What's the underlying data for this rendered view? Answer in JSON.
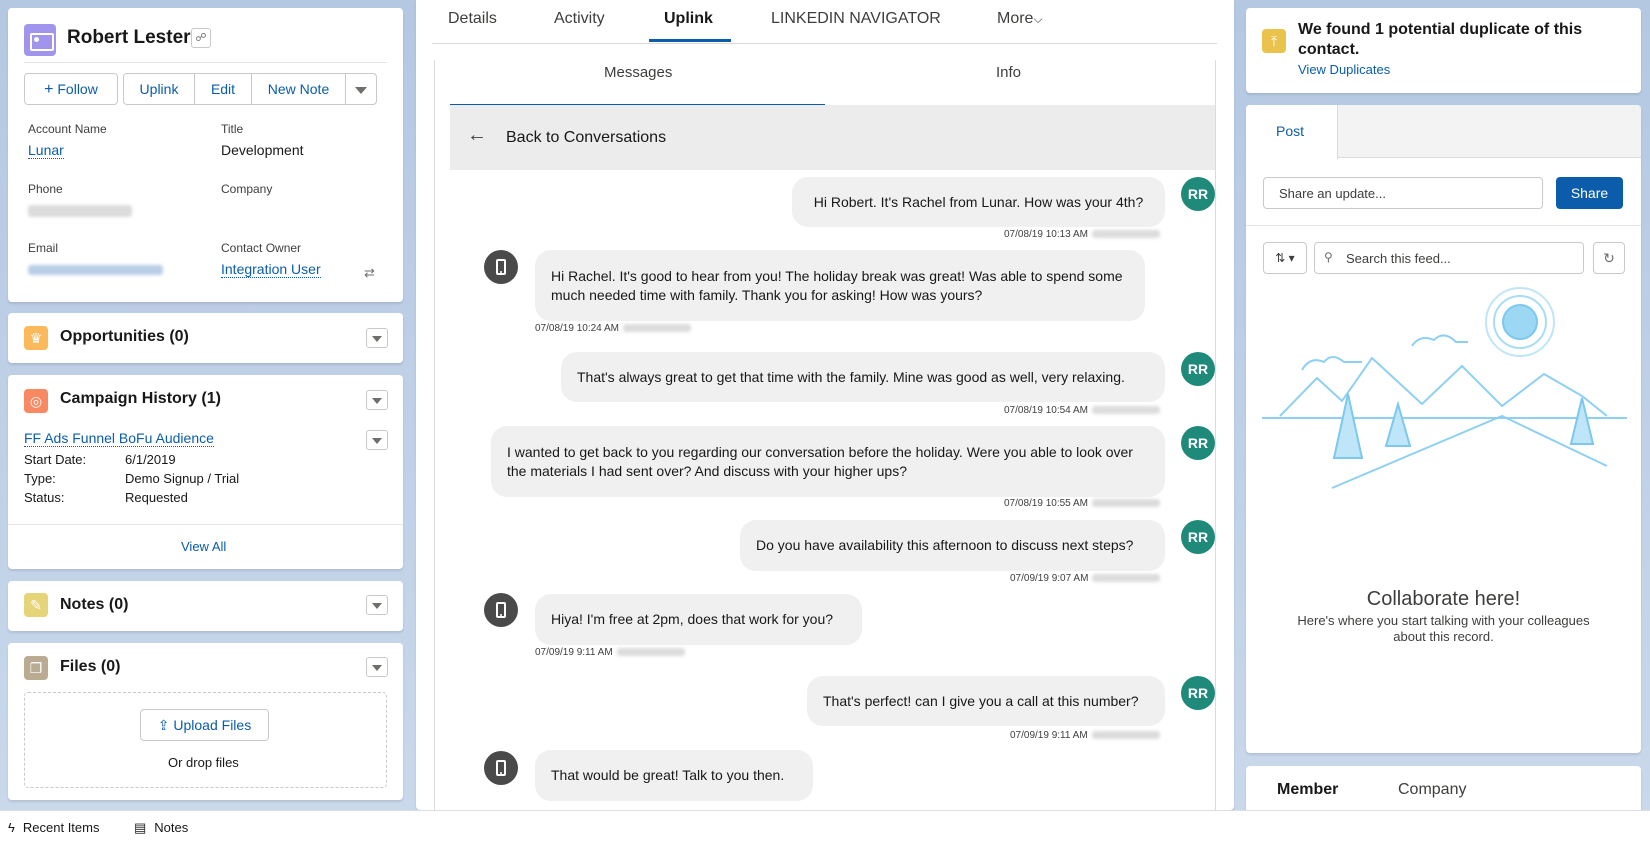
{
  "record": {
    "name": "Robert Lester",
    "actions": {
      "follow": "Follow",
      "uplink": "Uplink",
      "edit": "Edit",
      "new_note": "New Note"
    },
    "fields": {
      "account_name_label": "Account Name",
      "account_name": "Lunar",
      "title_label": "Title",
      "title": "Development",
      "phone_label": "Phone",
      "company_label": "Company",
      "email_label": "Email",
      "owner_label": "Contact Owner",
      "owner": "Integration User"
    }
  },
  "related": {
    "opportunities": "Opportunities (0)",
    "campaign_history": "Campaign History (1)",
    "campaign": {
      "name": "FF Ads Funnel BoFu Audience",
      "start_label": "Start Date:",
      "start": "6/1/2019",
      "type_label": "Type:",
      "type": "Demo Signup / Trial",
      "status_label": "Status:",
      "status": "Requested"
    },
    "view_all": "View All",
    "notes": "Notes (0)",
    "files": "Files (0)",
    "upload": "Upload Files",
    "drop": "Or drop files"
  },
  "tabs": {
    "details": "Details",
    "activity": "Activity",
    "uplink": "Uplink",
    "linkedin": "LINKEDIN NAVIGATOR",
    "more": "More"
  },
  "uplink": {
    "subtabs": {
      "messages": "Messages",
      "info": "Info"
    },
    "back": "Back to Conversations",
    "messages": [
      {
        "from": "RR",
        "text": "Hi Robert. It's Rachel from Lunar. How was your 4th?",
        "time": "07/08/19 10:13 AM"
      },
      {
        "from": "contact",
        "text": "Hi Rachel. It's good to hear from you! The holiday break was great! Was able to spend some much needed time with family. Thank you for asking! How was yours?",
        "time": "07/08/19 10:24 AM"
      },
      {
        "from": "RR",
        "text": "That's always great to get that time with the family. Mine was good as well, very relaxing.",
        "time": "07/08/19 10:54 AM"
      },
      {
        "from": "RR",
        "text": "I wanted to get back to you regarding our conversation before the holiday. Were you able to look over the materials I had sent over? And discuss with your higher ups?",
        "time": "07/08/19 10:55 AM"
      },
      {
        "from": "RR",
        "text": "Do you have availability this afternoon to discuss next steps?",
        "time": "07/09/19 9:07 AM"
      },
      {
        "from": "contact",
        "text": "Hiya! I'm free at 2pm, does that work for you?",
        "time": "07/09/19 9:11 AM"
      },
      {
        "from": "RR",
        "text": "That's perfect! can I give you a call at this number?",
        "time": "07/09/19 9:11 AM"
      },
      {
        "from": "contact",
        "text": "That would be great! Talk to you then.",
        "time": ""
      }
    ]
  },
  "duplicates": {
    "message": "We found 1 potential duplicate of this contact.",
    "link": "View Duplicates"
  },
  "feed": {
    "post_tab": "Post",
    "share_placeholder": "Share an update...",
    "share": "Share",
    "search_placeholder": "Search this feed...",
    "empty_title": "Collaborate here!",
    "empty_body": "Here's where you start talking with your colleagues about this record."
  },
  "member_tabs": {
    "member": "Member",
    "company": "Company"
  },
  "footer": {
    "recent": "Recent Items",
    "notes": "Notes"
  }
}
